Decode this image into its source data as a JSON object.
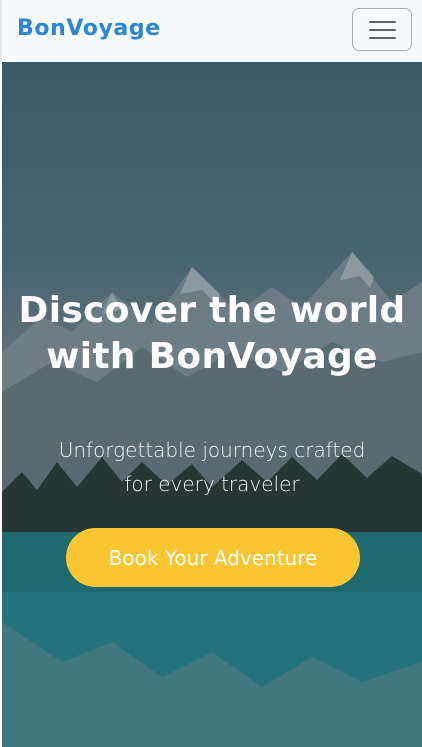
{
  "navbar": {
    "brand": "BonVoyage",
    "toggler_icon": "hamburger-menu-icon"
  },
  "hero": {
    "title": "Discover the world with BonVoyage",
    "subtitle": "Unforgettable journeys crafted for every traveler",
    "cta_label": "Book Your Adventure"
  },
  "colors": {
    "brand": "#2c86d8",
    "cta_background": "#f9c530",
    "navbar_background": "#f8f9fa"
  }
}
